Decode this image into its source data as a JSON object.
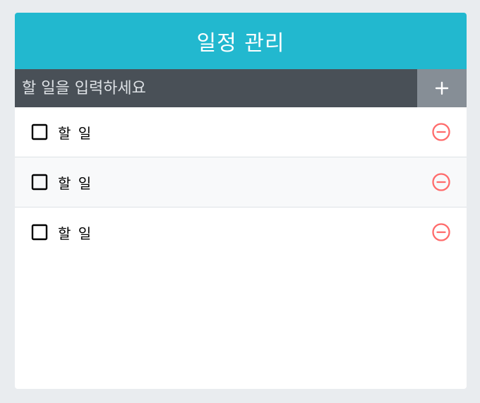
{
  "app": {
    "title": "일정 관리"
  },
  "insert": {
    "placeholder": "할 일을 입력하세요",
    "button_icon": "plus-icon"
  },
  "todos": [
    {
      "text": "할 일",
      "checked": false
    },
    {
      "text": "할 일",
      "checked": false
    },
    {
      "text": "할 일",
      "checked": false
    }
  ],
  "colors": {
    "header": "#22b8cf",
    "input_bg": "#495057",
    "button_bg": "#868e96",
    "remove": "#ff6b6b",
    "page_bg": "#e9ecef"
  }
}
